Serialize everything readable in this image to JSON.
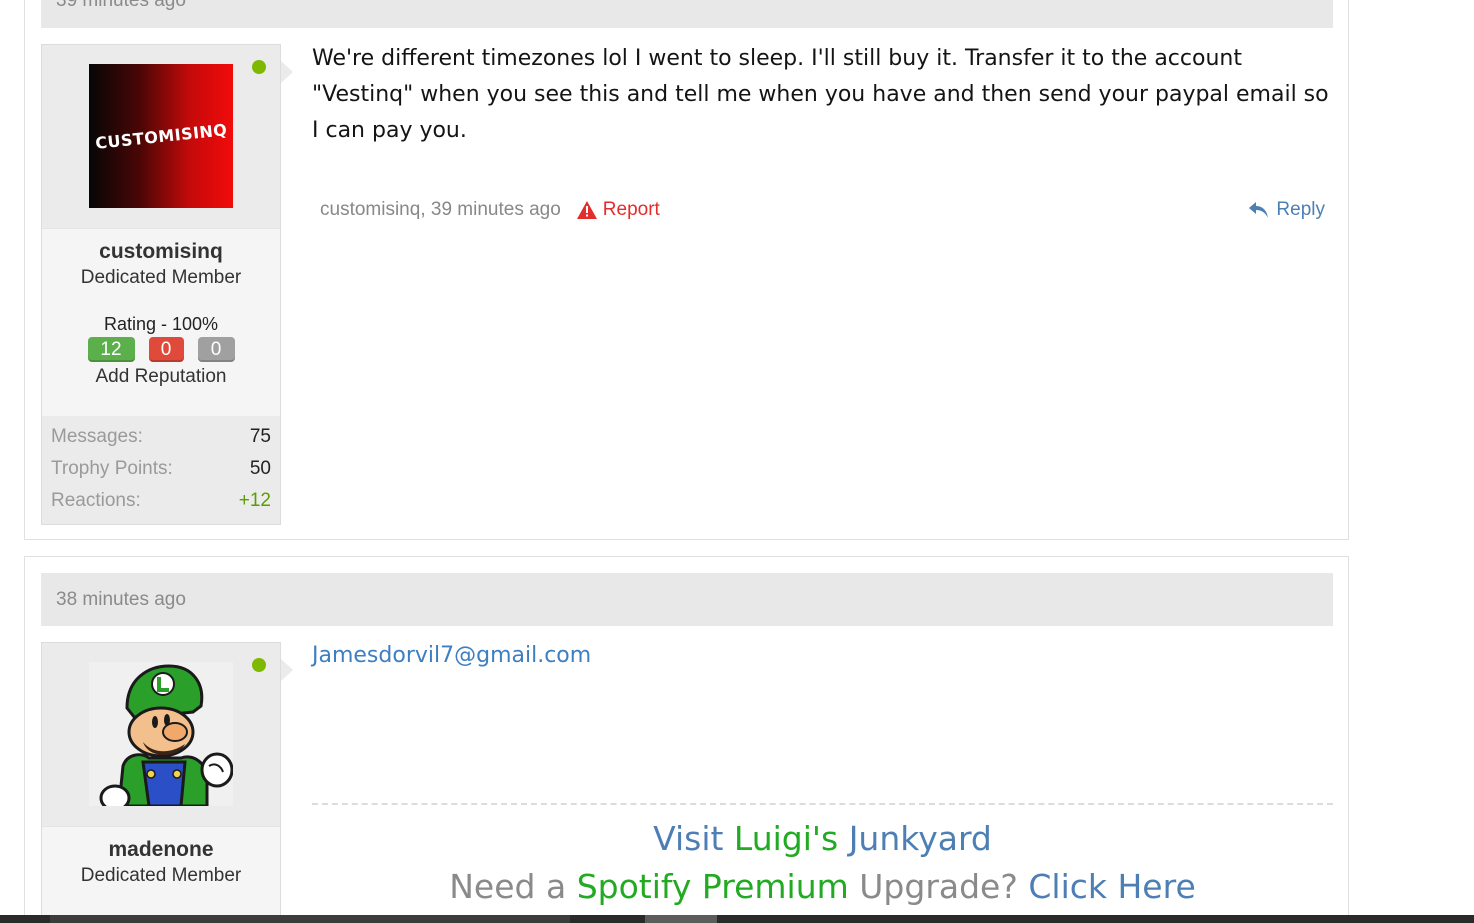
{
  "posts": [
    {
      "timestamp": "39 minutes ago",
      "user": {
        "avatar_text": "CUSTOMISINQ",
        "username": "customisinq",
        "title": "Dedicated Member",
        "rating": "Rating - 100%",
        "rep_positive": "12",
        "rep_negative": "0",
        "rep_neutral": "0",
        "add_reputation": "Add Reputation",
        "stats": [
          {
            "label": "Messages:",
            "value": "75"
          },
          {
            "label": "Trophy Points:",
            "value": "50"
          },
          {
            "label": "Reactions:",
            "value": "+12"
          }
        ]
      },
      "message": "We're different timezones lol I went to sleep. I'll still buy it. Transfer it to the account \"Vestinq\" when you see this and tell me when you have and then send your paypal email so I can pay you.",
      "footer": {
        "meta": "customisinq, 39 minutes ago",
        "report": "Report",
        "reply": "Reply"
      }
    },
    {
      "timestamp": "38 minutes ago",
      "user": {
        "username": "madenone",
        "title": "Dedicated Member"
      },
      "message": "Jamesdorvil7@gmail.com",
      "signature": {
        "line1": {
          "a": "Visit ",
          "b": "Luigi's",
          "c": " Junkyard"
        },
        "line2": {
          "a": "Need a ",
          "b": "Spotify Premium",
          "c": " Upgrade? ",
          "d": "Click Here"
        }
      }
    }
  ],
  "colors": {
    "online": "#7fb800",
    "link": "#4d7fb5",
    "report": "#e32c2c",
    "rep_positive": "#5cb04b",
    "rep_negative": "#e04a3a",
    "rep_neutral": "#a0a0a0",
    "signature_green": "#22aa22"
  },
  "icons": [
    "warning-triangle-icon",
    "reply-arrow-icon",
    "online-status-icon"
  ]
}
